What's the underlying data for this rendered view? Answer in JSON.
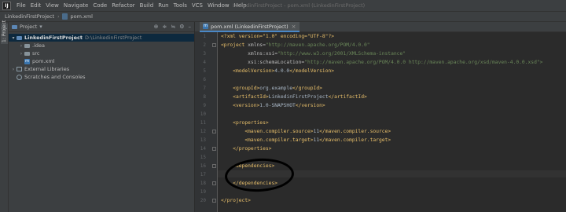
{
  "menubar": {
    "logo_text": "IJ",
    "items": [
      "File",
      "Edit",
      "View",
      "Navigate",
      "Code",
      "Refactor",
      "Build",
      "Run",
      "Tools",
      "VCS",
      "Window",
      "Help"
    ],
    "window_title": "LinkedinFirstProject - pom.xml (LinkedinFirstProject)"
  },
  "navbar": {
    "project": "LinkedinFirstProject",
    "file": "pom.xml"
  },
  "leftstrip": {
    "tab_label": "1: Project"
  },
  "project_panel": {
    "title": "Project",
    "tree": {
      "root_name": "LinkedinFirstProject",
      "root_path": "D:\\LinkedinFirstProject",
      "idea": ".idea",
      "src": "src",
      "pom": "pom.xml",
      "external": "External Libraries",
      "scratches": "Scratches and Consoles"
    }
  },
  "editor": {
    "tab_label": "pom.xml (LinkedinFirstProject)",
    "line_numbers": [
      "1",
      "2",
      "3",
      "4",
      "5",
      "6",
      "7",
      "8",
      "9",
      "10",
      "11",
      "12",
      "13",
      "14",
      "15",
      "16",
      "17",
      "18",
      "19",
      "20"
    ]
  },
  "code": {
    "l1": "<?xml version=\"1.0\" encoding=\"UTF-8\"?>",
    "l2_tag": "<project",
    "l2_attr": " xmlns=",
    "l2_val": "\"http://maven.apache.org/POM/4.0.0\"",
    "l3_attr": "         xmlns:xsi=",
    "l3_val": "\"http://www.w3.org/2001/XMLSchema-instance\"",
    "l4_attr": "         xsi:schemaLocation=",
    "l4_val": "\"http://maven.apache.org/POM/4.0.0 http://maven.apache.org/xsd/maven-4.0.0.xsd\">",
    "l5_open": "    <modelVersion>",
    "l5_text": "4.0.0",
    "l5_close": "</modelVersion>",
    "l7_open": "    <groupId>",
    "l7_text": "org.example",
    "l7_close": "</groupId>",
    "l8_open": "    <artifactId>",
    "l8_text": "LinkedinFirstProject",
    "l8_close": "</artifactId>",
    "l9_open": "    <version>",
    "l9_text": "1.0-SNAPSHOT",
    "l9_close": "</version>",
    "l11": "    <properties>",
    "l12_open": "        <maven.compiler.source>",
    "l12_text": "11",
    "l12_close": "</maven.compiler.source>",
    "l13_open": "        <maven.compiler.target>",
    "l13_text": "11",
    "l13_close": "</maven.compiler.target>",
    "l14": "    </properties>",
    "l16": "    <dependencies>",
    "l18": "    </dependencies>",
    "l20": "</project>"
  },
  "colors": {
    "tag": "#e8bf6a",
    "attribute": "#bababa",
    "value": "#6a8759",
    "text": "#a9b7c6",
    "annotation": "#000000"
  }
}
